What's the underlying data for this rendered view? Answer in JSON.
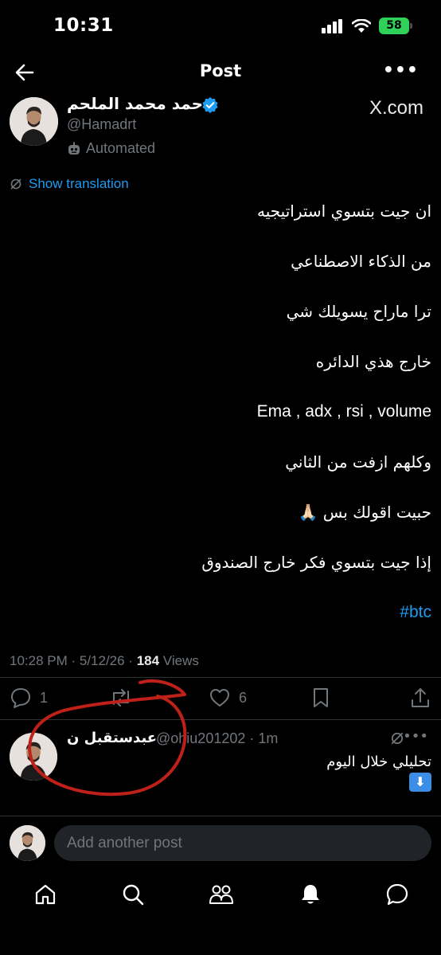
{
  "status_bar": {
    "time": "10:31",
    "battery": "58"
  },
  "header": {
    "title": "Post"
  },
  "post": {
    "author_name": "حمد محمد الملحم",
    "handle": "@Hamadrt",
    "automated_label": "Automated",
    "brand": "X.com",
    "show_translation": "Show translation",
    "lines": [
      "ان جيت بتسوي استراتيجيه",
      "من الذكاء الاصطناعي",
      "ترا ماراح يسويلك شي",
      "خارج هذي الدائره",
      "Ema , adx , rsi , volume",
      "وكلهم ازفت من الثاني",
      "حبيت اقولك بس 🙏🏻",
      "إذا جيت بتسوي فكر خارج الصندوق",
      "#btc"
    ],
    "timestamp": "10:28 PM · 5/12/26 · ",
    "views_count": "184",
    "views_label": " Views",
    "reply_count": "1",
    "like_count": "6"
  },
  "reply": {
    "name": "عبدستقبل ن",
    "handle": "@ohiu201202 · 1m",
    "text": "تحليلي خلال اليوم",
    "emoji": "⬇"
  },
  "compose": {
    "placeholder": "Add another post"
  },
  "colors": {
    "accent": "#1d9bf0",
    "annotation": "#c0201a",
    "verified": "#1d9bf0"
  }
}
